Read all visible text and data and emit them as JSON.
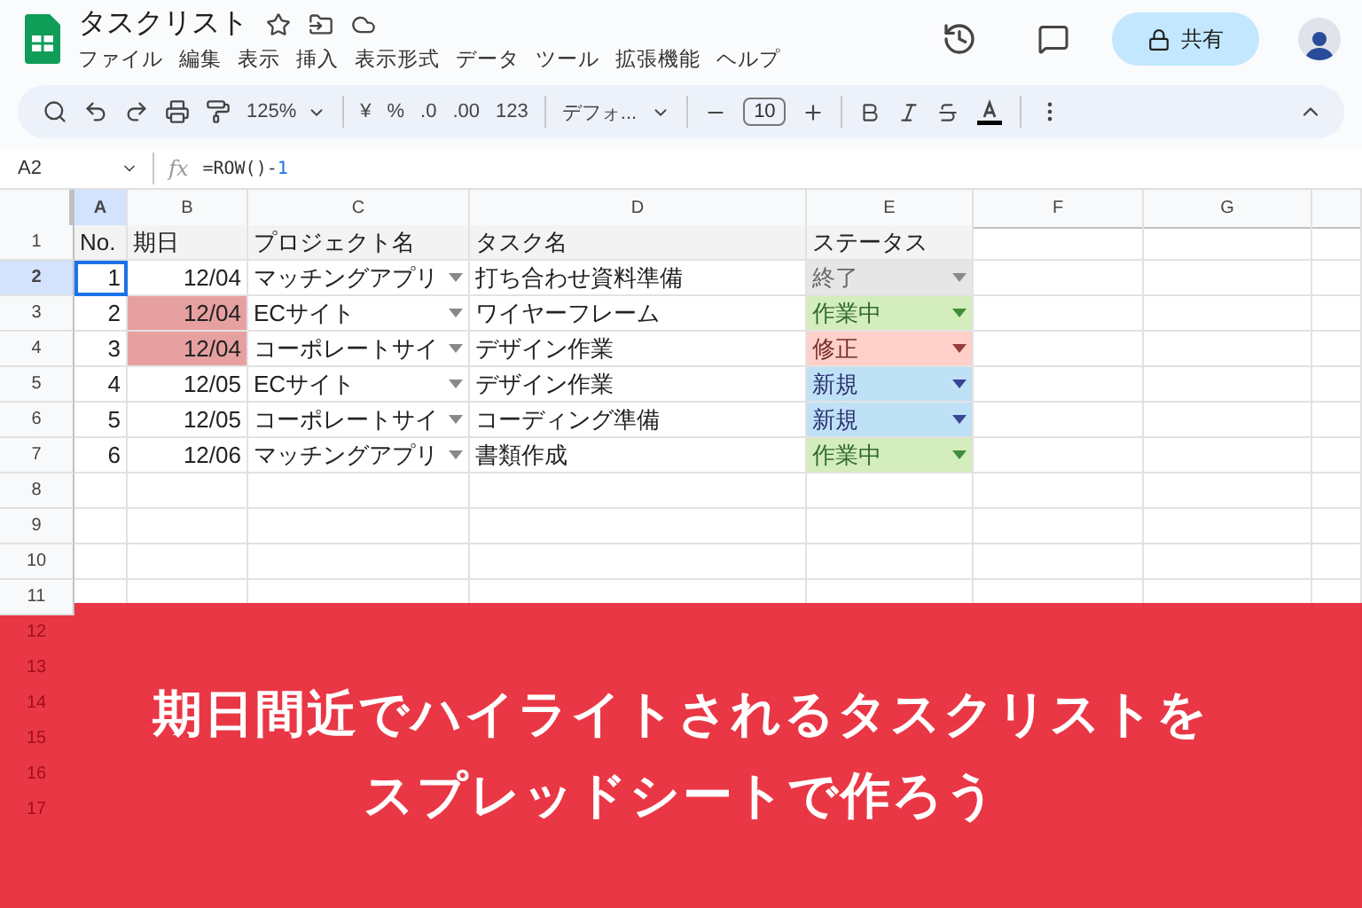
{
  "title": "タスクリスト",
  "menu": [
    "ファイル",
    "編集",
    "表示",
    "挿入",
    "表示形式",
    "データ",
    "ツール",
    "拡張機能",
    "ヘルプ"
  ],
  "share_button": "共有",
  "toolbar": {
    "zoom": "125%",
    "currency": "¥",
    "percent": "%",
    "decrease_decimal": ".0",
    "increase_decimal": ".00",
    "number_format": "123",
    "font": "デフォ...",
    "font_size": "10"
  },
  "name_box": "A2",
  "fx_label": "fx",
  "formula": {
    "text": "=ROW()-",
    "number": "1"
  },
  "columns": [
    {
      "label": "A",
      "selected": true
    },
    {
      "label": "B",
      "selected": false
    },
    {
      "label": "C",
      "selected": false
    },
    {
      "label": "D",
      "selected": false
    },
    {
      "label": "E",
      "selected": false
    },
    {
      "label": "F",
      "selected": false
    },
    {
      "label": "G",
      "selected": false
    }
  ],
  "header_row": {
    "number": "1",
    "cells": [
      "No.",
      "期日",
      "プロジェクト名",
      "タスク名",
      "ステータス"
    ]
  },
  "rows": [
    {
      "number": "2",
      "selected": true,
      "no": "1",
      "due": "12/04",
      "highlighted": false,
      "project": "マッチングアプリ",
      "task": "打ち合わせ資料準備",
      "status": "終了",
      "color": "#e6e6e6"
    },
    {
      "number": "3",
      "selected": false,
      "no": "2",
      "due": "12/04",
      "highlighted": true,
      "project": "ECサイト",
      "task": "ワイヤーフレーム",
      "status": "作業中",
      "color": "#d4edbc"
    },
    {
      "number": "4",
      "selected": false,
      "no": "3",
      "due": "12/04",
      "highlighted": true,
      "project": "コーポレートサイ",
      "task": "デザイン作業",
      "status": "修正",
      "color": "#ffcfc9"
    },
    {
      "number": "5",
      "selected": false,
      "no": "4",
      "due": "12/05",
      "highlighted": false,
      "project": "ECサイト",
      "task": "デザイン作業",
      "status": "新規",
      "color": "#bfe1f6"
    },
    {
      "number": "6",
      "selected": false,
      "no": "5",
      "due": "12/05",
      "highlighted": false,
      "project": "コーポレートサイ",
      "task": "コーディング準備",
      "status": "新規",
      "color": "#bfe1f6"
    },
    {
      "number": "7",
      "selected": false,
      "no": "6",
      "due": "12/06",
      "highlighted": false,
      "project": "マッチングアプリ",
      "task": "書類作成",
      "status": "作業中",
      "color": "#d4edbc"
    }
  ],
  "empty_rows": [
    "8",
    "9",
    "10",
    "11",
    "12",
    "13",
    "14",
    "15",
    "16",
    "17"
  ],
  "banner": [
    "期日間近でハイライトされるタスクリストを",
    "スプレッドシートで作ろう"
  ]
}
